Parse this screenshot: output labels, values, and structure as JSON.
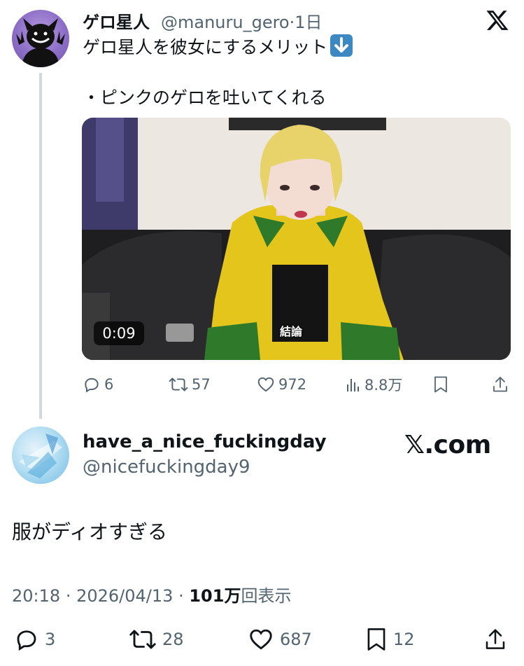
{
  "tweet1": {
    "display_name": "ゲロ星人",
    "handle": "@manuru_gero",
    "separator": "·",
    "time_ago": "1日",
    "text_line1": "ゲロ星人を彼女にするメリット",
    "text_emoji": "arrow-down-emoji",
    "text_line2": "・ピンクのゲロを吐いてくれる",
    "video": {
      "duration": "0:09",
      "caption": "結論"
    },
    "actions": {
      "replies": "6",
      "reposts": "57",
      "likes": "972",
      "views": "8.8万"
    }
  },
  "tweet2": {
    "display_name": "have_a_nice_fuckingday",
    "handle": "@nicefuckingday9",
    "watermark": "𝕏.com",
    "text": "服がディオすぎる",
    "meta": {
      "time": "20:18",
      "sep1": "·",
      "date": "2026/04/13",
      "sep2": "·",
      "views": "101万",
      "views_label": "回表示"
    },
    "actions": {
      "replies": "3",
      "reposts": "28",
      "likes": "687",
      "bookmarks": "12"
    }
  },
  "colors": {
    "text_primary": "#0f1419",
    "text_secondary": "#536471",
    "thread_line": "#cfd9de",
    "jacket_yellow": "#e3c51c",
    "jacket_green": "#2e7a2a"
  }
}
